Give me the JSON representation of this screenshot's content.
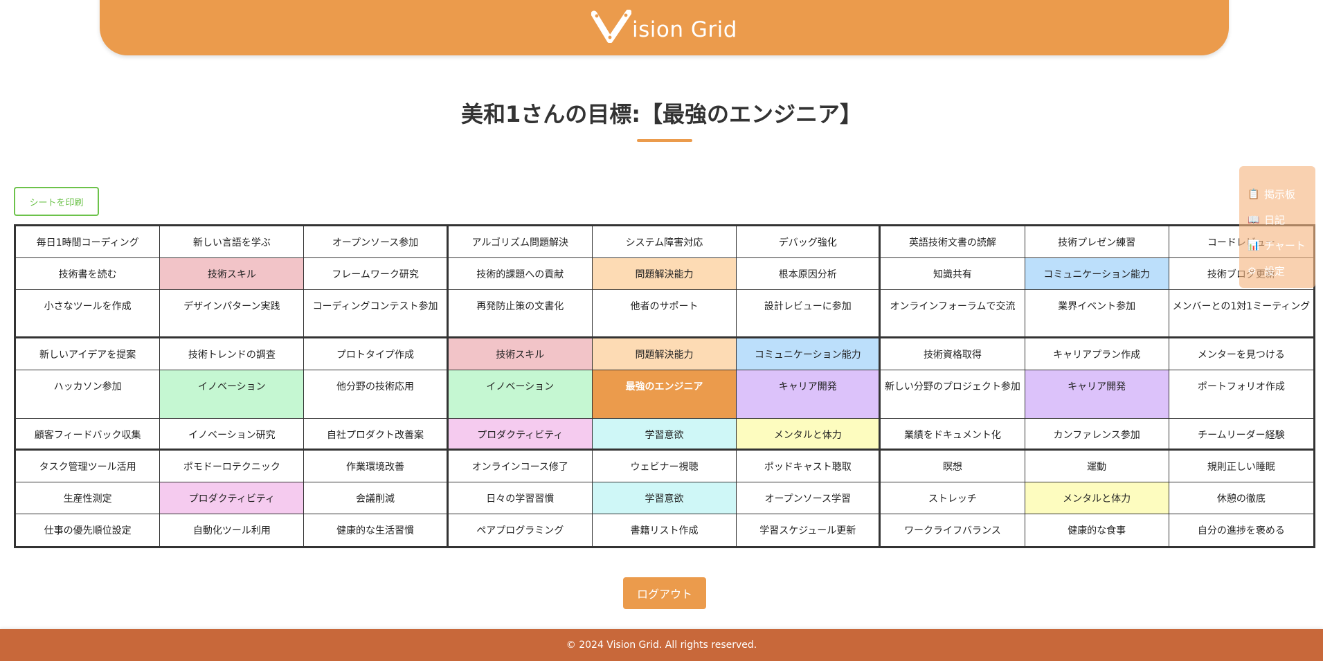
{
  "header": {
    "logo_text": "ision Grid",
    "logo_color": "#EB9B4C"
  },
  "page": {
    "title": "美和1さんの目標:【最強のエンジニア】"
  },
  "buttons": {
    "print_label": "シートを印刷",
    "logout_label": "ログアウト"
  },
  "side_menu": {
    "items": [
      {
        "icon": "clipboard-icon",
        "glyph": "📋",
        "label": "掲示板"
      },
      {
        "icon": "book-icon",
        "glyph": "📖",
        "label": "日記"
      },
      {
        "icon": "chart-icon",
        "glyph": "📊",
        "label": "チャート"
      },
      {
        "icon": "gear-icon",
        "glyph": "⚙",
        "label": "設定"
      }
    ]
  },
  "colors": {
    "skill": "#F2C4C8",
    "problem": "#FDDBB4",
    "communication": "#BCDFFB",
    "innovation": "#C5F7D2",
    "center": "#EB9B4C",
    "career": "#DCC2FA",
    "productivity": "#F5CBEF",
    "learning": "#CFF7F7",
    "mental": "#FDFCBF"
  },
  "grid": {
    "cells": [
      {
        "text": "毎日1時間コーディング"
      },
      {
        "text": "新しい言語を学ぶ"
      },
      {
        "text": "オープンソース参加"
      },
      {
        "text": "アルゴリズム問題解決"
      },
      {
        "text": "システム障害対応"
      },
      {
        "text": "デバッグ強化"
      },
      {
        "text": "英語技術文書の読解"
      },
      {
        "text": "技術プレゼン練習"
      },
      {
        "text": "コードレビュー"
      },
      {
        "text": "技術書を読む"
      },
      {
        "text": "技術スキル",
        "color": "skill"
      },
      {
        "text": "フレームワーク研究"
      },
      {
        "text": "技術的課題への貢献"
      },
      {
        "text": "問題解決能力",
        "color": "problem"
      },
      {
        "text": "根本原因分析"
      },
      {
        "text": "知識共有"
      },
      {
        "text": "コミュニケーション能力",
        "color": "communication"
      },
      {
        "text": "技術ブログ更新"
      },
      {
        "text": "小さなツールを作成"
      },
      {
        "text": "デザインパターン実践"
      },
      {
        "text": "コーディングコンテスト参加"
      },
      {
        "text": "再発防止策の文書化"
      },
      {
        "text": "他者のサポート"
      },
      {
        "text": "設計レビューに参加"
      },
      {
        "text": "オンラインフォーラムで交流"
      },
      {
        "text": "業界イベント参加"
      },
      {
        "text": "メンバーとの1対1ミーティング"
      },
      {
        "text": "新しいアイデアを提案"
      },
      {
        "text": "技術トレンドの調査"
      },
      {
        "text": "プロトタイプ作成"
      },
      {
        "text": "技術スキル",
        "color": "skill"
      },
      {
        "text": "問題解決能力",
        "color": "problem"
      },
      {
        "text": "コミュニケーション能力",
        "color": "communication"
      },
      {
        "text": "技術資格取得"
      },
      {
        "text": "キャリアプラン作成"
      },
      {
        "text": "メンターを見つける"
      },
      {
        "text": "ハッカソン参加"
      },
      {
        "text": "イノベーション",
        "color": "innovation"
      },
      {
        "text": "他分野の技術応用"
      },
      {
        "text": "イノベーション",
        "color": "innovation"
      },
      {
        "text": "最強のエンジニア",
        "color": "center",
        "center": true
      },
      {
        "text": "キャリア開発",
        "color": "career"
      },
      {
        "text": "新しい分野のプロジェクト参加"
      },
      {
        "text": "キャリア開発",
        "color": "career"
      },
      {
        "text": "ポートフォリオ作成"
      },
      {
        "text": "顧客フィードバック収集"
      },
      {
        "text": "イノベーション研究"
      },
      {
        "text": "自社プロダクト改善案"
      },
      {
        "text": "プロダクティビティ",
        "color": "productivity"
      },
      {
        "text": "学習意欲",
        "color": "learning"
      },
      {
        "text": "メンタルと体力",
        "color": "mental"
      },
      {
        "text": "業績をドキュメント化"
      },
      {
        "text": "カンファレンス参加"
      },
      {
        "text": "チームリーダー経験"
      },
      {
        "text": "タスク管理ツール活用"
      },
      {
        "text": "ポモドーロテクニック"
      },
      {
        "text": "作業環境改善"
      },
      {
        "text": "オンラインコース修了"
      },
      {
        "text": "ウェビナー視聴"
      },
      {
        "text": "ポッドキャスト聴取"
      },
      {
        "text": "瞑想"
      },
      {
        "text": "運動"
      },
      {
        "text": "規則正しい睡眠"
      },
      {
        "text": "生産性測定"
      },
      {
        "text": "プロダクティビティ",
        "color": "productivity"
      },
      {
        "text": "会議削減"
      },
      {
        "text": "日々の学習習慣"
      },
      {
        "text": "学習意欲",
        "color": "learning"
      },
      {
        "text": "オープンソース学習"
      },
      {
        "text": "ストレッチ"
      },
      {
        "text": "メンタルと体力",
        "color": "mental"
      },
      {
        "text": "休憩の徹底"
      },
      {
        "text": "仕事の優先順位設定"
      },
      {
        "text": "自動化ツール利用"
      },
      {
        "text": "健康的な生活習慣"
      },
      {
        "text": "ペアプログラミング"
      },
      {
        "text": "書籍リスト作成"
      },
      {
        "text": "学習スケジュール更新"
      },
      {
        "text": "ワークライフバランス"
      },
      {
        "text": "健康的な食事"
      },
      {
        "text": "自分の進捗を褒める"
      }
    ]
  },
  "footer": {
    "text": "© 2024 Vision Grid. All rights reserved."
  }
}
